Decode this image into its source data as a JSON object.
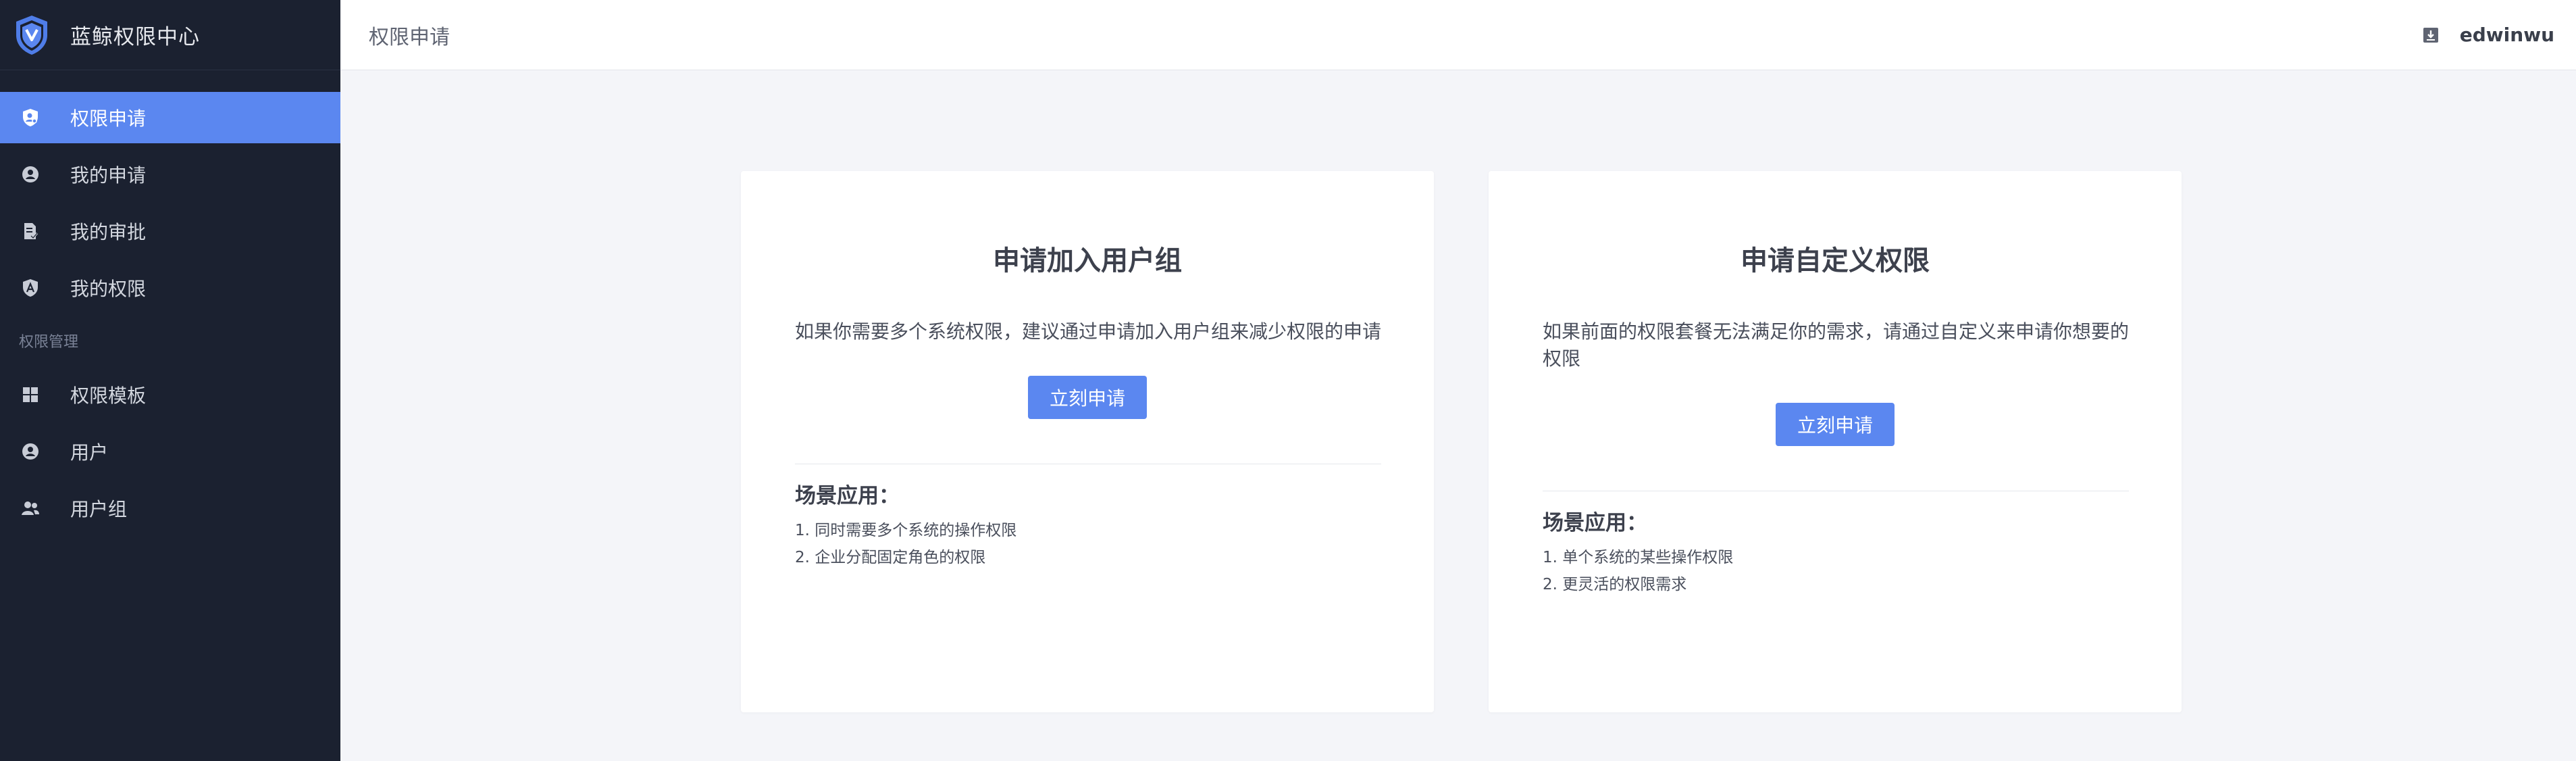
{
  "app": {
    "title": "蓝鲸权限中心"
  },
  "sidebar": {
    "items": [
      {
        "label": "权限申请",
        "icon": "shield-user-icon",
        "active": true
      },
      {
        "label": "我的申请",
        "icon": "user-circle-icon",
        "active": false
      },
      {
        "label": "我的审批",
        "icon": "document-check-icon",
        "active": false
      },
      {
        "label": "我的权限",
        "icon": "shield-a-icon",
        "active": false
      }
    ],
    "section_label": "权限管理",
    "manage_items": [
      {
        "label": "权限模板",
        "icon": "grid-icon"
      },
      {
        "label": "用户",
        "icon": "user-circle-icon"
      },
      {
        "label": "用户组",
        "icon": "users-icon"
      }
    ]
  },
  "header": {
    "page_title": "权限申请",
    "username": "edwinwu"
  },
  "cards": [
    {
      "title": "申请加入用户组",
      "description": "如果你需要多个系统权限，建议通过申请加入用户组来减少权限的申请",
      "button": "立刻申请",
      "scene_title": "场景应用：",
      "scenes": [
        "1. 同时需要多个系统的操作权限",
        "2. 企业分配固定角色的权限"
      ]
    },
    {
      "title": "申请自定义权限",
      "description": "如果前面的权限套餐无法满足你的需求，请通过自定义来申请你想要的权限",
      "button": "立刻申请",
      "scene_title": "场景应用：",
      "scenes": [
        "1. 单个系统的某些操作权限",
        "2. 更灵活的权限需求"
      ]
    }
  ],
  "colors": {
    "sidebar_bg": "#1b2130",
    "accent": "#5b87f0",
    "page_bg": "#f4f5f9"
  }
}
